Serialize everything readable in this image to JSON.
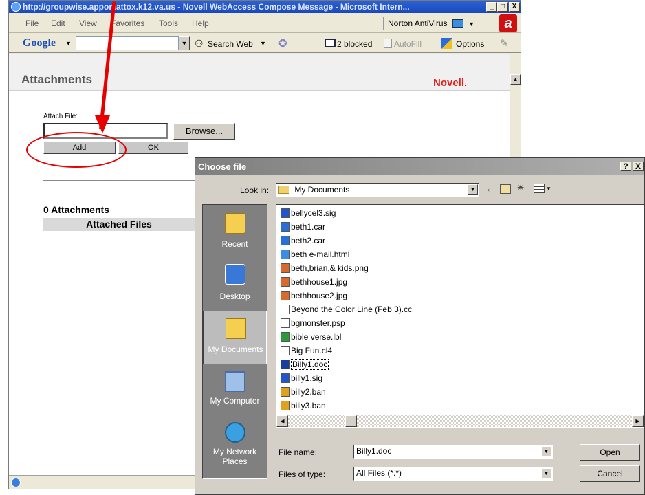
{
  "window": {
    "title": "http://groupwise.appomattox.k12.va.us - Novell WebAccess Compose Message - Microsoft Intern...",
    "controls": [
      "_",
      "□",
      "X"
    ]
  },
  "menubar": {
    "items": [
      "File",
      "Edit",
      "View",
      "Favorites",
      "Tools",
      "Help"
    ],
    "norton": "Norton AntiVirus"
  },
  "google_toolbar": {
    "logo": "Google",
    "search_web": "Search Web",
    "blocked": "2 blocked",
    "autofill": "AutoFill",
    "options": "Options"
  },
  "page": {
    "heading": "Attachments",
    "brand": "Novell.",
    "attach_file_label": "Attach File:",
    "browse_label": "Browse...",
    "add_label": "Add",
    "ok_label": "OK",
    "attachments_count": "0 Attachments",
    "attached_files_header": "Attached Files"
  },
  "dialog": {
    "title": "Choose file",
    "help": "?",
    "close": "X",
    "look_in_label": "Look in:",
    "look_in_value": "My Documents",
    "places": [
      "Recent",
      "Desktop",
      "My Documents",
      "My Computer",
      "My Network Places"
    ],
    "files": [
      {
        "name": "bellycel3.sig",
        "icon": "sig-icon"
      },
      {
        "name": "beth1.car",
        "icon": "car-icon"
      },
      {
        "name": "beth2.car",
        "icon": "car-icon"
      },
      {
        "name": "beth e-mail.html",
        "icon": "html-icon"
      },
      {
        "name": "beth,brian,& kids.png",
        "icon": "image-icon"
      },
      {
        "name": "bethhouse1.jpg",
        "icon": "image-icon"
      },
      {
        "name": "bethhouse2.jpg",
        "icon": "image-icon"
      },
      {
        "name": "Beyond the Color Line (Feb 3).cc",
        "icon": "doc-icon"
      },
      {
        "name": "bgmonster.psp",
        "icon": "doc-icon"
      },
      {
        "name": "bible verse.lbl",
        "icon": "label-icon"
      },
      {
        "name": "Big Fun.cl4",
        "icon": "doc-icon"
      },
      {
        "name": "Billy1.doc",
        "icon": "word-icon",
        "selected": true
      },
      {
        "name": "billy1.sig",
        "icon": "sig-icon"
      },
      {
        "name": "billy2.ban",
        "icon": "ban-icon"
      },
      {
        "name": "billy3.ban",
        "icon": "ban-icon"
      }
    ],
    "file_name_label": "File name:",
    "file_name_value": "Billy1.doc",
    "files_of_type_label": "Files of type:",
    "files_of_type_value": "All Files (*.*)",
    "open_label": "Open",
    "cancel_label": "Cancel"
  },
  "colors": {
    "annotation": "#e80000",
    "titlebar": "#1b48b8",
    "novell": "#e0201b"
  }
}
